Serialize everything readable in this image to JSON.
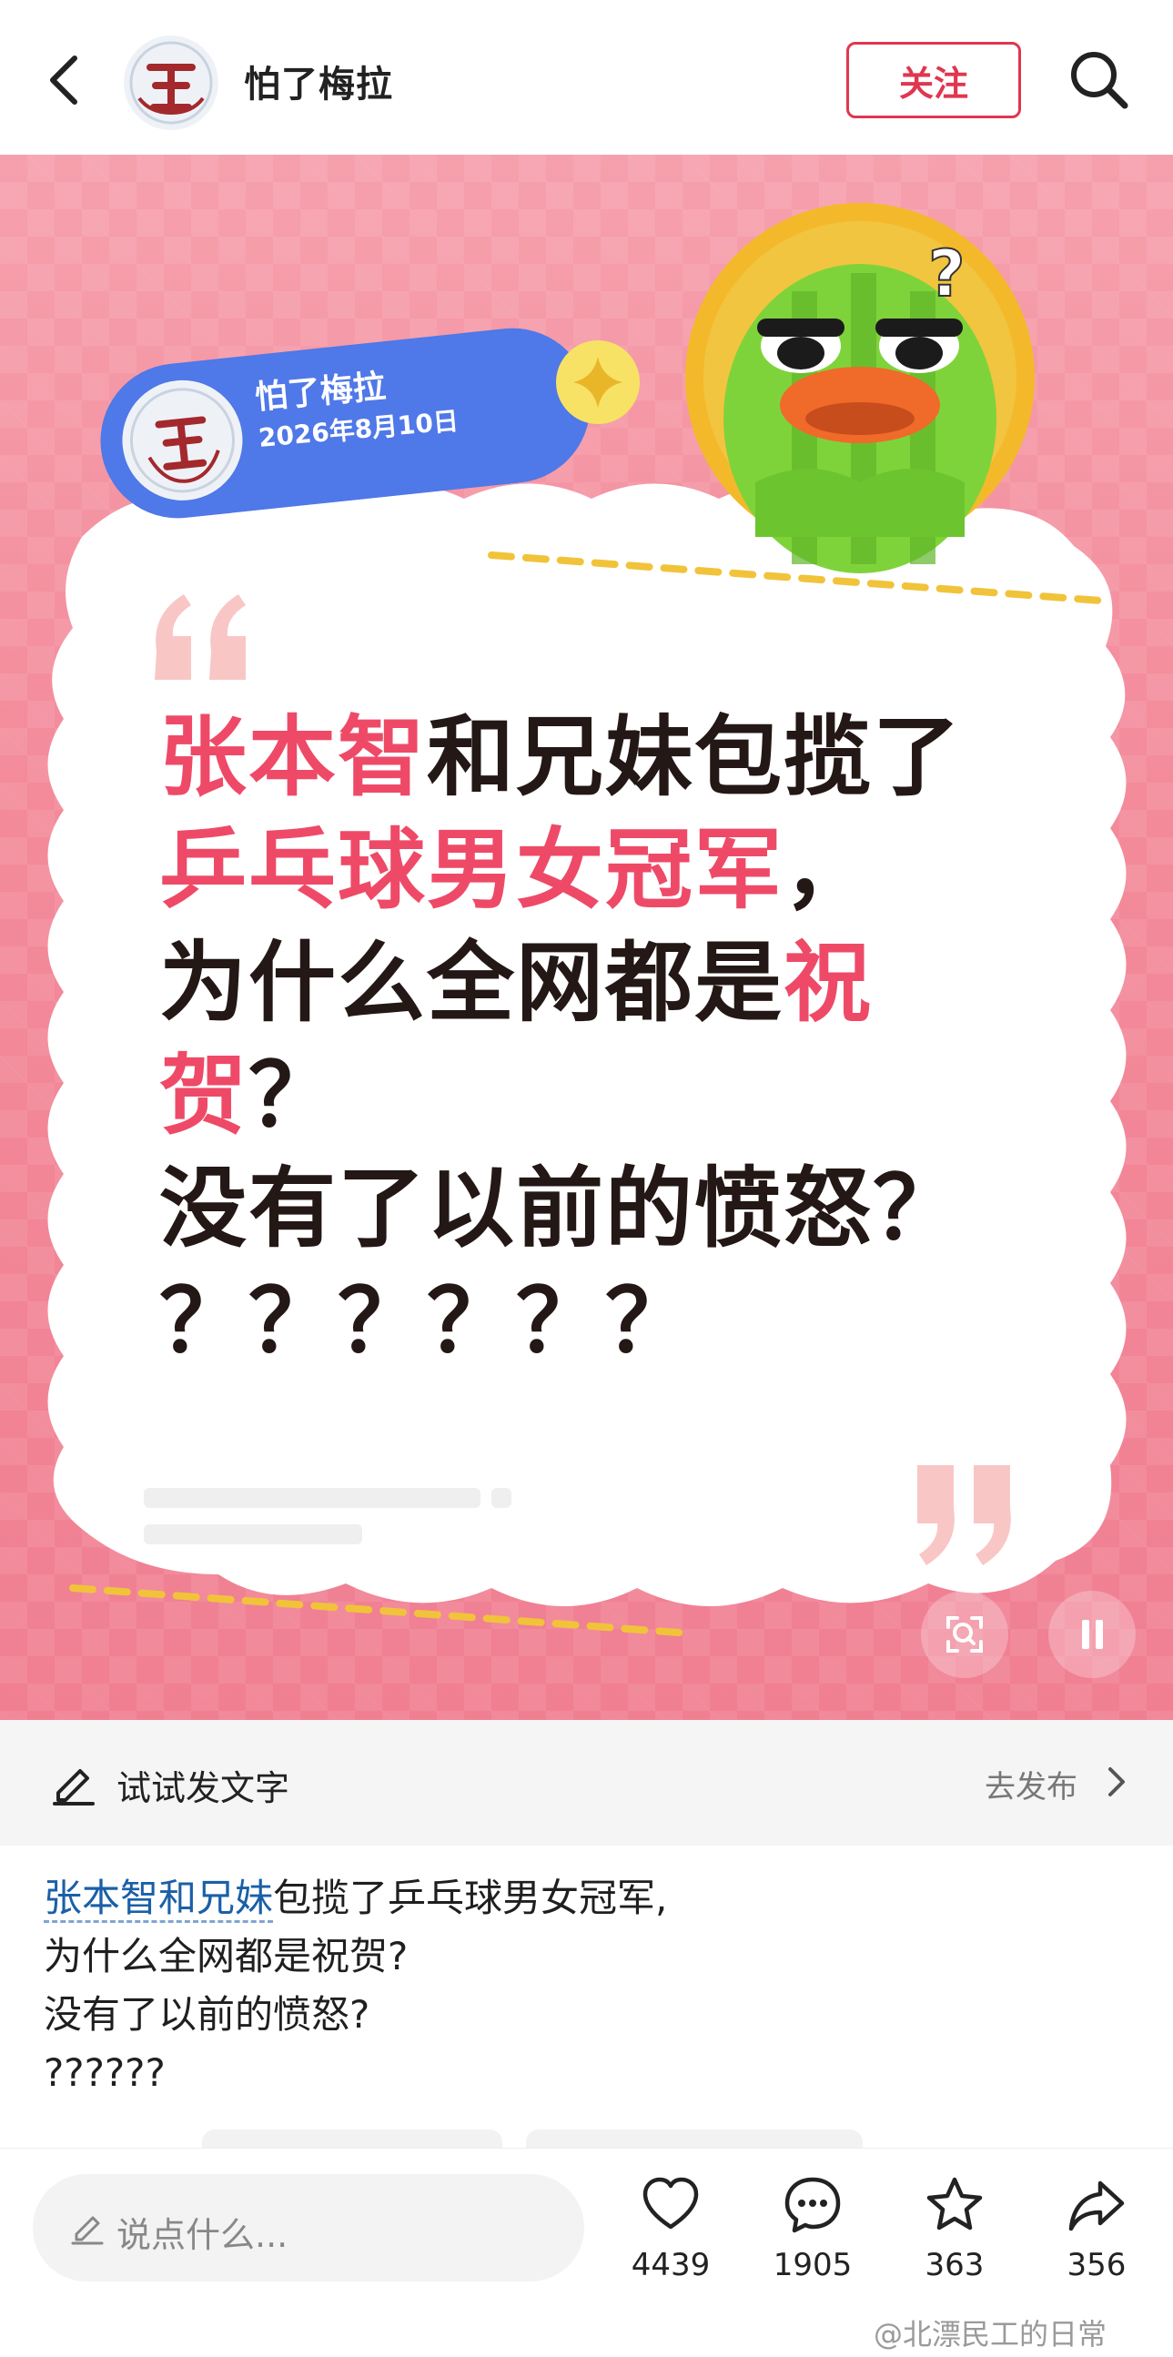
{
  "header": {
    "title": "怕了梅拉",
    "follow_label": "关注"
  },
  "card": {
    "pill_name": "怕了梅拉",
    "pill_date": "2026年8月10日",
    "lines": [
      [
        {
          "t": "张本智",
          "h": true
        },
        {
          "t": "和兄妹包揽了",
          "h": false
        }
      ],
      [
        {
          "t": "乒乓球男女冠军",
          "h": true
        },
        {
          "t": "，",
          "h": false
        }
      ],
      [
        {
          "t": "为什么全网都是",
          "h": false
        },
        {
          "t": "祝",
          "h": true
        }
      ],
      [
        {
          "t": "贺",
          "h": true
        },
        {
          "t": "？",
          "h": false
        }
      ],
      [
        {
          "t": "没有了以前的愤怒？",
          "h": false
        }
      ],
      [
        {
          "t": "？？？？？？",
          "h": false
        }
      ]
    ],
    "sticker_mark": "?"
  },
  "try_bar": {
    "label": "试试发文字",
    "publish_label": "去发布"
  },
  "post": {
    "link_text": "张本智和兄妹",
    "line1_rest": "包揽了乒乓球男女冠军,",
    "line2": "为什么全网都是祝贺?",
    "line3": "没有了以前的愤怒?",
    "line4": "??????"
  },
  "bottom_bar": {
    "comment_placeholder": "说点什么...",
    "likes": "4439",
    "comments": "1905",
    "favorites": "363",
    "shares": "356"
  },
  "watermark": "@北漂民工的日常",
  "colors": {
    "accent": "#e0364f",
    "highlight": "#ee4a68",
    "card_bg": "#f38b9b",
    "pill_blue": "#4f78e8",
    "link": "#1a5fa8"
  },
  "icons": [
    "back-arrow-icon",
    "search-icon",
    "sparkle-icon",
    "scan-icon",
    "pause-icon",
    "pencil-icon",
    "chevron-right-icon",
    "heart-icon",
    "comment-bubble-icon",
    "star-icon",
    "share-arrow-icon"
  ]
}
